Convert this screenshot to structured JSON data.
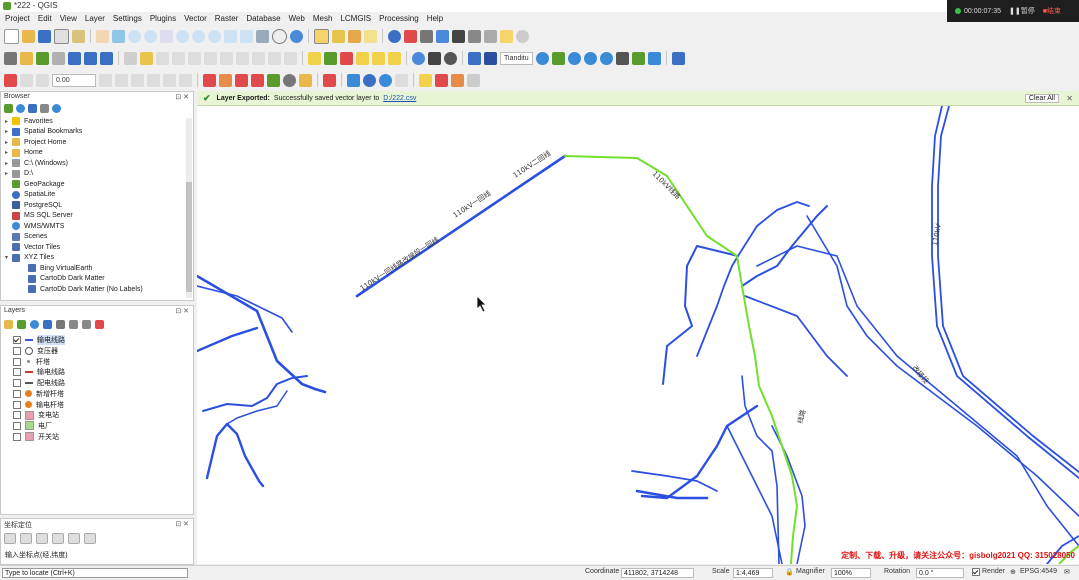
{
  "window": {
    "title": "*222 - QGIS"
  },
  "recorder": {
    "status": "00:00:07:35",
    "pause": "暂停",
    "stop": "结束"
  },
  "menu": [
    "Project",
    "Edit",
    "View",
    "Layer",
    "Settings",
    "Plugins",
    "Vector",
    "Raster",
    "Database",
    "Web",
    "Mesh",
    "LCMGIS",
    "Processing",
    "Help"
  ],
  "toolbar2": {
    "plugin_label": "Tianditu"
  },
  "toolbar3": {
    "font_size": "0.00"
  },
  "browser": {
    "title": "Browser",
    "items": [
      {
        "label": "Favorites",
        "icon": "star-icon",
        "arrow": "▸"
      },
      {
        "label": "Spatial Bookmarks",
        "icon": "bookmark-icon",
        "arrow": "▸"
      },
      {
        "label": "Project Home",
        "icon": "folder-icon",
        "arrow": "▸"
      },
      {
        "label": "Home",
        "icon": "folder-icon",
        "arrow": "▸"
      },
      {
        "label": "C:\\ (Windows)",
        "icon": "drive-icon",
        "arrow": "▸"
      },
      {
        "label": "D:\\",
        "icon": "drive-icon",
        "arrow": "▸"
      },
      {
        "label": "GeoPackage",
        "icon": "geopackage-icon",
        "arrow": ""
      },
      {
        "label": "SpatiaLite",
        "icon": "spatialite-icon",
        "arrow": ""
      },
      {
        "label": "PostgreSQL",
        "icon": "postgresql-icon",
        "arrow": ""
      },
      {
        "label": "MS SQL Server",
        "icon": "mssql-icon",
        "arrow": ""
      },
      {
        "label": "WMS/WMTS",
        "icon": "globe-icon",
        "arrow": ""
      },
      {
        "label": "Scenes",
        "icon": "scenes-icon",
        "arrow": ""
      },
      {
        "label": "Vector Tiles",
        "icon": "grid-icon",
        "arrow": ""
      },
      {
        "label": "XYZ Tiles",
        "icon": "grid-icon",
        "arrow": "▾"
      },
      {
        "label": "Bing VirtualEarth",
        "icon": "grid-icon",
        "arrow": "",
        "indent": true
      },
      {
        "label": "CartoDb Dark Matter",
        "icon": "grid-icon",
        "arrow": "",
        "indent": true
      },
      {
        "label": "CartoDb Dark Matter (No Labels)",
        "icon": "grid-icon",
        "arrow": "",
        "indent": true
      }
    ]
  },
  "layers": {
    "title": "Layers",
    "items": [
      {
        "label": "输电线路",
        "checked": true,
        "symbol": "line",
        "color": "#3a57d6"
      },
      {
        "label": "变压器",
        "checked": false,
        "symbol": "circle",
        "color": "#555555"
      },
      {
        "label": "杆塔",
        "checked": false,
        "symbol": "dot",
        "color": "#888888"
      },
      {
        "label": "输电线路",
        "checked": false,
        "symbol": "line",
        "color": "#c0392b"
      },
      {
        "label": "配电线路",
        "checked": false,
        "symbol": "line",
        "color": "#555555"
      },
      {
        "label": "新增杆塔",
        "checked": false,
        "symbol": "circle-fill",
        "color": "#e67e22"
      },
      {
        "label": "输电杆塔",
        "checked": false,
        "symbol": "circle-fill",
        "color": "#e67e22"
      },
      {
        "label": "变电站",
        "checked": false,
        "symbol": "square",
        "color": "#e8a0b0"
      },
      {
        "label": "电厂",
        "checked": false,
        "symbol": "square",
        "color": "#a8d890"
      },
      {
        "label": "开关站",
        "checked": false,
        "symbol": "square",
        "color": "#e8a0b0"
      }
    ]
  },
  "identify": {
    "title": "坐标定位",
    "label": "输入坐标点(经,纬度)"
  },
  "message": {
    "title": "Layer Exported:",
    "text": "Successfully saved vector layer to",
    "link": "D:/222.csv",
    "clear": "Clear All"
  },
  "map": {
    "line_color": "#2b4fe0",
    "highlight_color": "#72e02a",
    "labels": [
      "110kV一回线路改接段一回线",
      "110kV一回线",
      "110kV二回线",
      "110kV线路",
      "线路",
      "110kV",
      "改接段"
    ]
  },
  "watermark": "定制、下载、升级，请关注公众号：gisbolg2021   QQ: 315028050",
  "status": {
    "locator_placeholder": "Type to locate (Ctrl+K)",
    "coordinate_label": "Coordinate",
    "coordinate": "411802, 3714248",
    "scale_label": "Scale",
    "scale": "1:4,469",
    "magnifier_label": "Magnifier",
    "magnifier": "100%",
    "rotation_label": "Rotation",
    "rotation": "0.0 °",
    "render_label": "Render",
    "crs": "EPSG:4549"
  }
}
